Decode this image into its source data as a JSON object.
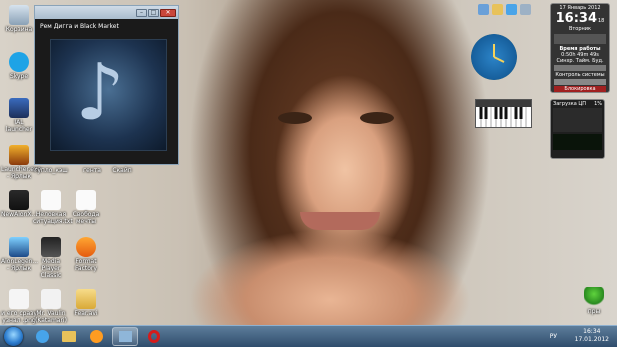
{
  "desktop_icons": [
    {
      "label": "Корзина"
    },
    {
      "label": "Skype"
    },
    {
      "label": "IAL launcher"
    },
    {
      "label": "Launcher.exe - Ярлык"
    },
    {
      "label": "NewAionX..."
    },
    {
      "label": "AionLegen... - Ярлык"
    },
    {
      "label": "и его сразу узнал .png"
    },
    {
      "label": "Неловкая ситуация.txt"
    },
    {
      "label": "Свобода мечты"
    },
    {
      "label": "Media Player Classic"
    },
    {
      "label": "Format Factory"
    },
    {
      "label": "Mr. Vaulin (Katamari)"
    },
    {
      "label": "Fear.avi"
    },
    {
      "label": "гупло_кэш"
    },
    {
      "label": "гента"
    },
    {
      "label": "Скайп"
    },
    {
      "label": "пры"
    }
  ],
  "player": {
    "title": "Рем Дигга и Black Market",
    "min": "–",
    "max": "□",
    "close": "✕"
  },
  "calendar": {
    "date": "17 Январь 2012",
    "time": "16:34",
    "seconds": "18",
    "weekday": "Вторник",
    "uptime_label": "Время работы",
    "uptime_value": "0:50h 49m 49s",
    "sync_label": "Синхр.   Тайм.   Буд.",
    "control_label": "Контроль системы",
    "lock_label": "Блокировка"
  },
  "cpu": {
    "title": "Загрузка ЦП",
    "percent": "1%"
  },
  "tray": {
    "language": "РУ",
    "time": "16:34",
    "date": "17.01.2012"
  }
}
